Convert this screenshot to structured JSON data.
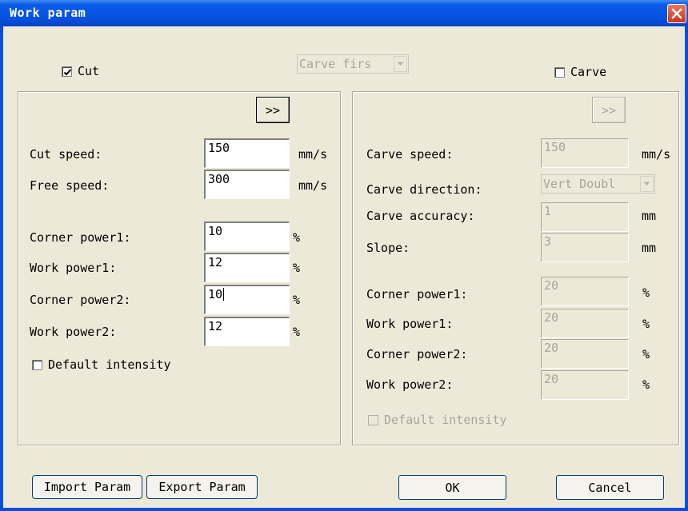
{
  "window": {
    "title": "Work param"
  },
  "top": {
    "cut_checkbox": {
      "label": "Cut",
      "checked": true
    },
    "order_select": {
      "value": "Carve firs"
    },
    "carve_checkbox": {
      "label": "Carve",
      "checked": false
    }
  },
  "cut_panel": {
    "expand_label": ">>",
    "fields": [
      {
        "label": "Cut speed:",
        "value": "150",
        "unit": "mm/s"
      },
      {
        "label": "Free speed:",
        "value": "300",
        "unit": "mm/s"
      },
      {
        "label": "Corner power1:",
        "value": "10",
        "unit": "%"
      },
      {
        "label": "Work power1:",
        "value": "12",
        "unit": "%"
      },
      {
        "label": "Corner power2:",
        "value": "10",
        "unit": "%"
      },
      {
        "label": "Work power2:",
        "value": "12",
        "unit": "%"
      }
    ],
    "default_intensity": {
      "label": "Default intensity",
      "checked": false
    }
  },
  "carve_panel": {
    "expand_label": ">>",
    "carve_speed": {
      "label": "Carve speed:",
      "value": "150",
      "unit": "mm/s"
    },
    "carve_direction": {
      "label": "Carve direction:",
      "value": "Vert Doubl"
    },
    "carve_accuracy": {
      "label": "Carve accuracy:",
      "value": "1",
      "unit": "mm"
    },
    "slope": {
      "label": "Slope:",
      "value": "3",
      "unit": "mm"
    },
    "powers": [
      {
        "label": "Corner power1:",
        "value": "20",
        "unit": "%"
      },
      {
        "label": "Work power1:",
        "value": "20",
        "unit": "%"
      },
      {
        "label": "Corner power2:",
        "value": "20",
        "unit": "%"
      },
      {
        "label": "Work power2:",
        "value": "20",
        "unit": "%"
      }
    ],
    "default_intensity": {
      "label": "Default intensity",
      "checked": false
    }
  },
  "footer": {
    "import_label": "Import Param",
    "export_label": "Export Param",
    "ok_label": "OK",
    "cancel_label": "Cancel"
  },
  "colors": {
    "titlebar": "#0551e0",
    "dialog_bg": "#ece9d8",
    "disabled_text": "#a7a69b"
  }
}
